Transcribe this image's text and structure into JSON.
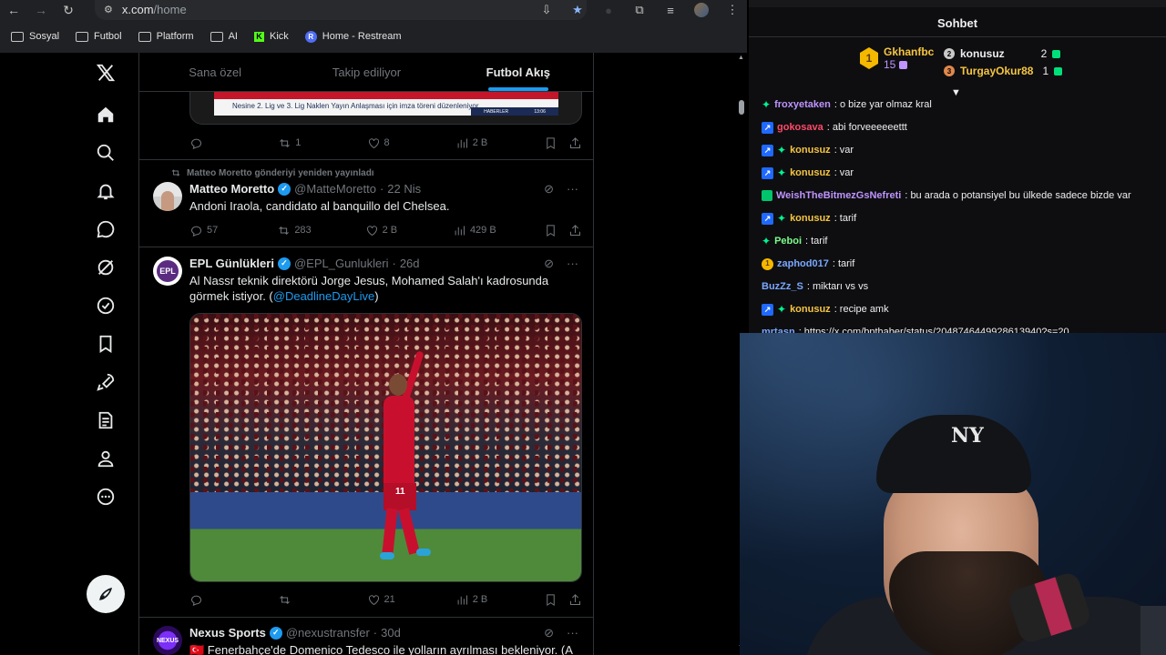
{
  "browser": {
    "url_host": "x.com",
    "url_path": "/home",
    "bookmarks": [
      {
        "label": "Sosyal",
        "icon": "folder-icon"
      },
      {
        "label": "Futbol",
        "icon": "folder-icon"
      },
      {
        "label": "Platform",
        "icon": "folder-icon"
      },
      {
        "label": "AI",
        "icon": "folder-icon"
      },
      {
        "label": "Kick",
        "icon": "kick-logo"
      },
      {
        "label": "Home - Restream",
        "icon": "restream-logo"
      }
    ]
  },
  "x": {
    "tabs": [
      {
        "label": "Sana özel",
        "active": false
      },
      {
        "label": "Takip ediliyor",
        "active": false
      },
      {
        "label": "Futbol Akış",
        "active": true
      }
    ],
    "prev_post": {
      "banner_text": "Nesine 2. Lig ve 3. Lig Naklen Yayın Anlaşması için imza töreni düzenleniyor",
      "banner_tag": "HABERLER",
      "banner_time": "13:06",
      "reposts": "1",
      "likes": "8",
      "views": "2 B"
    },
    "posts": [
      {
        "repost_note": "Matteo Moretto gönderiyi yeniden yayınladı",
        "name": "Matteo Moretto",
        "handle": "@MatteMoretto",
        "dot": "·",
        "time": "22 Nis",
        "text": "Andoni Iraola, candidato al banquillo del Chelsea.",
        "replies": "57",
        "reposts": "283",
        "likes": "2 B",
        "views": "429 B"
      },
      {
        "name": "EPL Günlükleri",
        "handle": "@EPL_Gunlukleri",
        "dot": "·",
        "time": "26d",
        "text": "Al Nassr teknik direktörü Jorge Jesus, Mohamed Salah'ı kadrosunda görmek istiyor. (",
        "link": "@DeadlineDayLive",
        "text_end": ")",
        "avatar_text": "EPL",
        "jersey_number": "11",
        "replies": "",
        "reposts": "",
        "likes": "21",
        "views": "2 B"
      },
      {
        "name": "Nexus Sports",
        "handle": "@nexustransfer",
        "dot": "·",
        "time": "30d",
        "text": "🇹🇷 Fenerbahçe'de Domenico Tedesco ile yolların ayrılması bekleniyor. (A",
        "avatar_text": "NEXUS"
      }
    ]
  },
  "chat": {
    "title": "Sohbet",
    "leaders": [
      {
        "rank": "1",
        "name": "Gkhanfbc",
        "count": "15"
      },
      {
        "rank": "2",
        "name": "konusuz",
        "count": "2"
      },
      {
        "rank": "3",
        "name": "TurgayOkur88",
        "count": "1"
      }
    ],
    "messages": [
      {
        "user": "froxyetaken",
        "color": "#bf94ff",
        "badges": [
          "star"
        ],
        "text": ": o bize yar olmaz kral"
      },
      {
        "user": "gokosava",
        "color": "#ff4a6a",
        "badges": [
          "prime"
        ],
        "text": ": abi forveeeeeettt"
      },
      {
        "user": "konusuz",
        "color": "#f5c542",
        "badges": [
          "prime",
          "star"
        ],
        "text": ": var"
      },
      {
        "user": "konusuz",
        "color": "#f5c542",
        "badges": [
          "prime",
          "star"
        ],
        "text": ": var"
      },
      {
        "user": "WeishTheBitmezGsNefreti",
        "color": "#bf94ff",
        "badges": [
          "gift"
        ],
        "text": ": bu arada o potansiyel bu ülkede sadece bizde var"
      },
      {
        "user": "konusuz",
        "color": "#f5c542",
        "badges": [
          "prime",
          "star"
        ],
        "text": ": tarif"
      },
      {
        "user": "Peboi",
        "color": "#7cfc8a",
        "badges": [
          "star"
        ],
        "text": ": tarif"
      },
      {
        "user": "zaphod017",
        "color": "#7aa7ff",
        "badges": [
          "one"
        ],
        "text": ": tarif"
      },
      {
        "user": "BuzZz_S",
        "color": "#7aa7ff",
        "badges": [],
        "text": ": miktarı vs vs"
      },
      {
        "user": "konusuz",
        "color": "#f5c542",
        "badges": [
          "prime",
          "star"
        ],
        "text": ": recipe amk"
      },
      {
        "user": "mrtasn",
        "color": "#7aa7ff",
        "badges": [],
        "text": ": https://x.com/bpthaber/status/2048746449928613940?s=20"
      }
    ]
  }
}
